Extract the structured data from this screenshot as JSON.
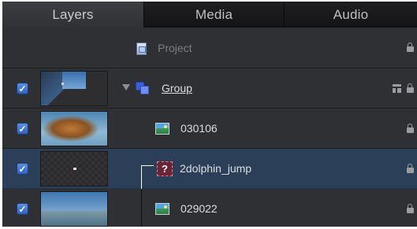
{
  "tabs": [
    {
      "label": "Layers",
      "active": true
    },
    {
      "label": "Media",
      "active": false
    },
    {
      "label": "Audio",
      "active": false
    }
  ],
  "layers": [
    {
      "name": "Project",
      "icon": "project-icon",
      "checked": null,
      "thumbnail": null,
      "selected": false
    },
    {
      "name": "Group",
      "icon": "group-icon",
      "checked": true,
      "thumbnail": "group-thumbnail",
      "expanded": true,
      "selected": false
    },
    {
      "name": "030106",
      "icon": "image-icon",
      "checked": true,
      "thumbnail": "tiger-thumbnail",
      "selected": false
    },
    {
      "name": "2dolphin_jump",
      "icon": "missing-media-icon",
      "missing_glyph": "?",
      "checked": true,
      "thumbnail": "empty-thumbnail",
      "selected": true
    },
    {
      "name": "029022",
      "icon": "image-icon",
      "checked": true,
      "thumbnail": "dolphins-thumbnail",
      "selected": false
    }
  ],
  "checkmark": "✓",
  "colors": {
    "panel_bg": "#2f3033",
    "selected_row": "#2b3f59",
    "checkbox": "#4a7fd6",
    "missing_badge": "#6d2438"
  }
}
